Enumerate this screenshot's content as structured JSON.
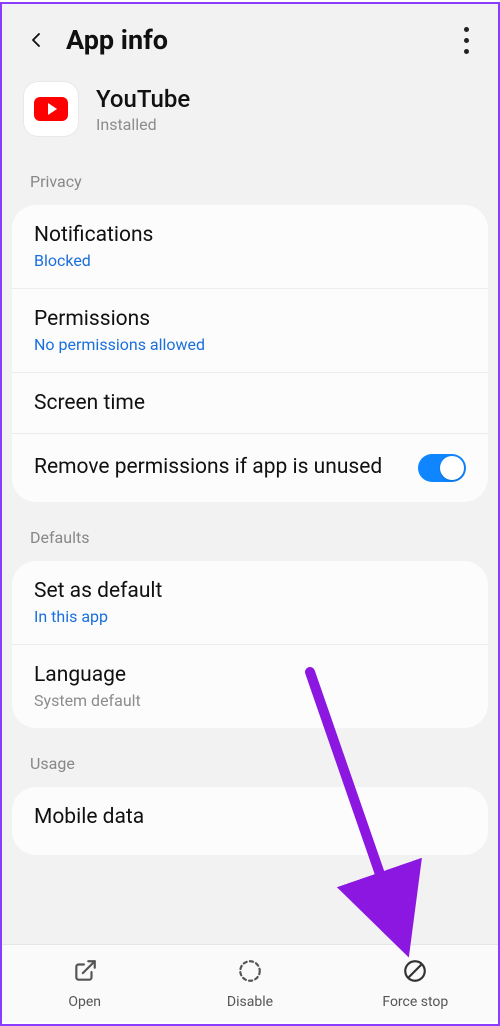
{
  "header": {
    "title": "App info"
  },
  "app": {
    "name": "YouTube",
    "status": "Installed"
  },
  "sections": {
    "privacy": {
      "label": "Privacy",
      "notifications": {
        "title": "Notifications",
        "sub": "Blocked"
      },
      "permissions": {
        "title": "Permissions",
        "sub": "No permissions allowed"
      },
      "screentime": {
        "title": "Screen time"
      },
      "removePerm": {
        "title": "Remove permissions if app is unused",
        "enabled": true
      }
    },
    "defaults": {
      "label": "Defaults",
      "setDefault": {
        "title": "Set as default",
        "sub": "In this app"
      },
      "language": {
        "title": "Language",
        "sub": "System default"
      }
    },
    "usage": {
      "label": "Usage",
      "mobileData": {
        "title": "Mobile data"
      }
    }
  },
  "bottomBar": {
    "open": "Open",
    "disable": "Disable",
    "forceStop": "Force stop"
  },
  "annotation": {
    "arrowColor": "#8b17e0"
  }
}
